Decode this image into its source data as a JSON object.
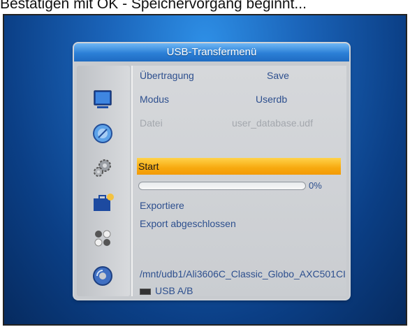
{
  "caption": "Bestätigen mit OK - Speichervorgang beginnt...",
  "dialog": {
    "title": "USB-Transfermenü",
    "rows": {
      "transfer_label": "Übertragung",
      "transfer_value": "Save",
      "mode_label": "Modus",
      "mode_value": "Userdb",
      "file_label": "Datei",
      "file_value": "user_database.udf"
    },
    "start_label": "Start",
    "progress": {
      "percent_text": "0%",
      "fraction": 0
    },
    "status_lines": [
      "Exportiere",
      "Export abgeschlossen"
    ],
    "path": "/mnt/udb1/Ali3606C_Classic_Globo_AXC501CI",
    "usb_label": "USB A/B"
  },
  "side_icons": [
    "tv-icon",
    "satellite-dish-icon",
    "gears-icon",
    "toolbox-icon",
    "media-icon",
    "disc-icon"
  ],
  "colors": {
    "highlight": "#f7a90f",
    "title_bar": "#2b7fd6",
    "text": "#2d4f8e",
    "background": "#1a63b8"
  }
}
